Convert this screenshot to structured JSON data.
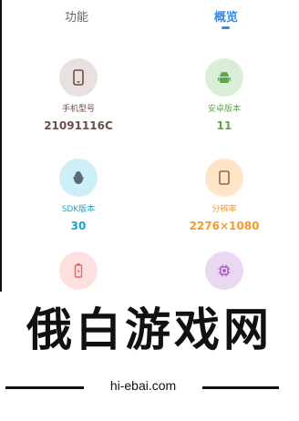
{
  "tabs": [
    {
      "label": "功能",
      "active": false
    },
    {
      "label": "概览",
      "active": true
    }
  ],
  "accent_color": "#2d8cf0",
  "items": [
    {
      "icon": "phone-icon",
      "label": "手机型号",
      "value": "21091116C",
      "color": "#6b4f45"
    },
    {
      "icon": "android-icon",
      "label": "安卓版本",
      "value": "11",
      "color": "#5aa84a"
    },
    {
      "icon": "sdk-icon",
      "label": "SDK版本",
      "value": "30",
      "color": "#1fa3c9"
    },
    {
      "icon": "screen-icon",
      "label": "分辨率",
      "value": "2276×1080",
      "color": "#f29a2e"
    },
    {
      "icon": "battery-icon",
      "label": "",
      "value": "",
      "color": "#e36464"
    },
    {
      "icon": "chip-icon",
      "label": "",
      "value": "",
      "color": "#9b5cc4"
    }
  ],
  "watermark": {
    "title": "俄白游戏网",
    "domain": "hi-ebai.com"
  }
}
